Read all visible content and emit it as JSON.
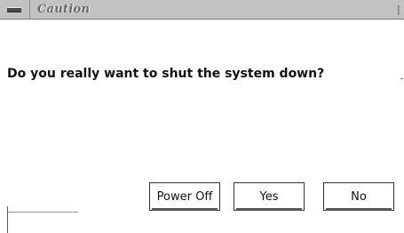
{
  "window": {
    "title": "Caution",
    "menu_icon": "window-menu-icon",
    "right_mark": "|"
  },
  "message": "Do you really want to shut the system down?",
  "buttons": {
    "power_off": "Power Off",
    "yes": "Yes",
    "no": "No"
  },
  "colors": {
    "titlebar": "#c2c2c2",
    "background": "#ffffff",
    "text": "#111111"
  }
}
